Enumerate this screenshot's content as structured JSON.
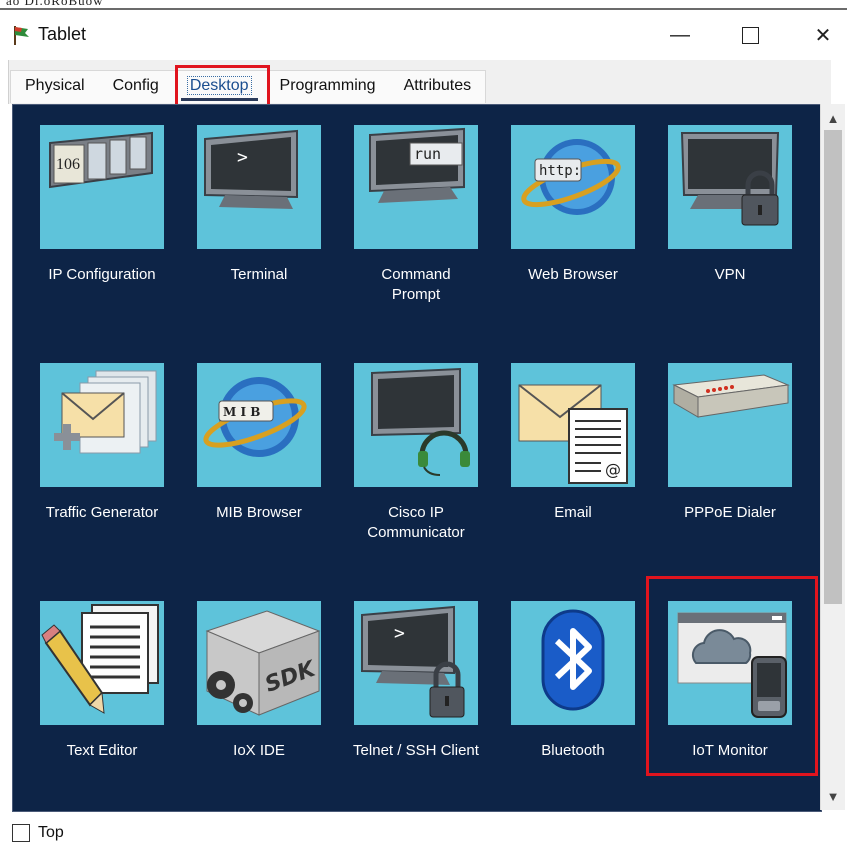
{
  "window": {
    "partial_header_text": "ao Dl.oRoBuow",
    "title": "Tablet",
    "min_symbol": "—",
    "close_symbol": "✕"
  },
  "tabs": [
    {
      "label": "Physical"
    },
    {
      "label": "Config"
    },
    {
      "label": "Desktop",
      "active": true
    },
    {
      "label": "Programming"
    },
    {
      "label": "Attributes"
    }
  ],
  "apps": [
    {
      "label": "IP Configuration",
      "icon": "ip-configuration-icon"
    },
    {
      "label": "Terminal",
      "icon": "terminal-icon"
    },
    {
      "label": "Command Prompt",
      "icon": "command-prompt-icon"
    },
    {
      "label": "Web Browser",
      "icon": "web-browser-icon"
    },
    {
      "label": "VPN",
      "icon": "vpn-icon"
    },
    {
      "label": "Traffic Generator",
      "icon": "traffic-generator-icon"
    },
    {
      "label": "MIB Browser",
      "icon": "mib-browser-icon"
    },
    {
      "label": "Cisco IP Communicator",
      "icon": "cisco-ip-communicator-icon"
    },
    {
      "label": "Email",
      "icon": "email-icon"
    },
    {
      "label": "PPPoE Dialer",
      "icon": "pppoe-dialer-icon"
    },
    {
      "label": "Text Editor",
      "icon": "text-editor-icon"
    },
    {
      "label": "IoX IDE",
      "icon": "iox-ide-icon"
    },
    {
      "label": "Telnet / SSH Client",
      "icon": "telnet-ssh-client-icon"
    },
    {
      "label": "Bluetooth",
      "icon": "bluetooth-icon"
    },
    {
      "label": "IoT Monitor",
      "icon": "iot-monitor-icon"
    }
  ],
  "icon_text": {
    "ip_number": "106",
    "terminal_prompt": ">",
    "run": "run",
    "http": "http:",
    "mib": "M I B",
    "sdk": "SDK",
    "at": "@"
  },
  "scrollbar": {
    "up": "▲",
    "down": "▼"
  },
  "footer": {
    "top_label": "Top",
    "top_checked": false
  },
  "colors": {
    "desktop_background": "#0d2447",
    "tile_background": "#5ec3da",
    "annotation_red": "#e0141e"
  }
}
